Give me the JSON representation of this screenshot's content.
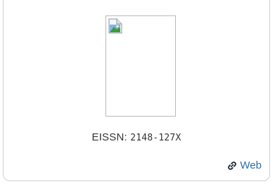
{
  "card": {
    "issn_label": "EISSN:",
    "issn_value": "2148-127X",
    "web_link_label": "Web"
  },
  "icons": {
    "cover": "broken-image-icon",
    "link": "link-icon"
  },
  "colors": {
    "link": "#2a6fa8",
    "text": "#333333",
    "border": "#c9d0d6"
  }
}
